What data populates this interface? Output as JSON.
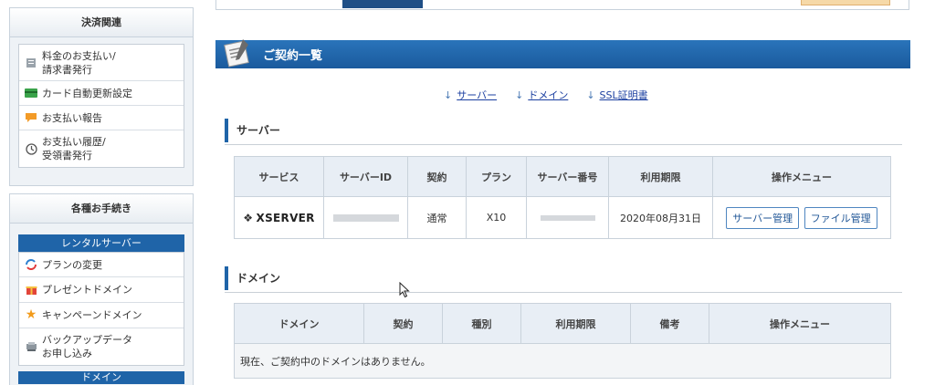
{
  "sidebar": {
    "payment": {
      "title": "決済関連",
      "items": [
        {
          "label_line1": "料金のお支払い/",
          "label_line2": "請求書発行",
          "icon": "invoice-icon"
        },
        {
          "label_line1": "カード自動更新設定",
          "label_line2": "",
          "icon": "credit-card-icon"
        },
        {
          "label_line1": "お支払い報告",
          "label_line2": "",
          "icon": "report-icon"
        },
        {
          "label_line1": "お支払い履歴/",
          "label_line2": "受領書発行",
          "icon": "clock-icon"
        }
      ]
    },
    "procedures": {
      "title": "各種お手続き",
      "rental_server_label": "レンタルサーバー",
      "items": [
        {
          "label_line1": "プランの変更",
          "label_line2": "",
          "icon": "plan-change-icon"
        },
        {
          "label_line1": "プレゼントドメイン",
          "label_line2": "",
          "icon": "gift-icon"
        },
        {
          "label_line1": "キャンペーンドメイン",
          "label_line2": "",
          "icon": "star-icon"
        },
        {
          "label_line1": "バックアップデータ",
          "label_line2": "お申し込み",
          "icon": "backup-icon"
        }
      ],
      "domain_label": "ドメイン"
    }
  },
  "main": {
    "title": "ご契約一覧",
    "anchors": {
      "server": "サーバー",
      "domain": "ドメイン",
      "ssl": "SSL証明書"
    },
    "server_section": {
      "title": "サーバー",
      "headers": [
        "サービス",
        "サーバーID",
        "契約",
        "プラン",
        "サーバー番号",
        "利用期限",
        "操作メニュー"
      ],
      "row": {
        "service": "XSERVER",
        "contract": "通常",
        "plan": "X10",
        "expiry": "2020年08月31日",
        "server_manage_label": "サーバー管理",
        "file_manage_label": "ファイル管理"
      }
    },
    "domain_section": {
      "title": "ドメイン",
      "headers": [
        "ドメイン",
        "契約",
        "種別",
        "利用期限",
        "備考",
        "操作メニュー"
      ],
      "empty_message": "現在、ご契約中のドメインはありません。"
    }
  },
  "colors": {
    "accent": "#1f64a8",
    "title_bar": "#1a5a9d",
    "link": "#1b3fa0"
  }
}
